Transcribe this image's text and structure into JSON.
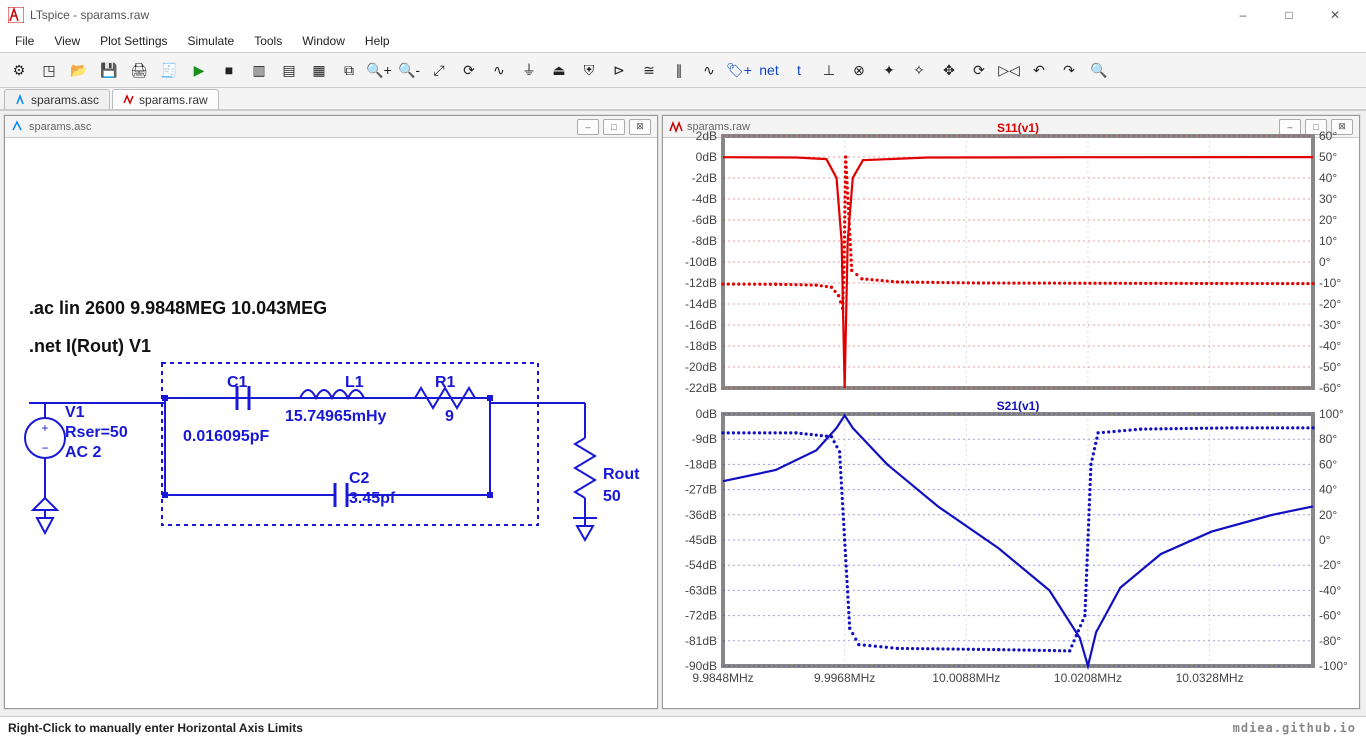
{
  "window": {
    "title": "LTspice - sparams.raw",
    "minimize": "–",
    "maximize": "□",
    "close": "✕"
  },
  "menu": [
    "File",
    "View",
    "Plot Settings",
    "Simulate",
    "Tools",
    "Window",
    "Help"
  ],
  "toolbar_icons": [
    "settings",
    "new-symbol",
    "open",
    "save",
    "print",
    "log",
    "run",
    "halt",
    "window-tile",
    "windows-h",
    "windows-v",
    "copy",
    "zoom-in",
    "zoom-out",
    "zoom-fit",
    "autorange",
    "sine",
    "ground-wire",
    "ground",
    "shield",
    "diode",
    "resistor",
    "capacitor",
    "inductor",
    "add-net",
    "net",
    "text",
    "pin-low",
    "pin-close",
    "marker-left",
    "marker-right",
    "move",
    "rotate",
    "mirror",
    "undo",
    "redo",
    "search"
  ],
  "doctabs": [
    {
      "label": "sparams.asc",
      "icon": "schematic-icon",
      "active": false
    },
    {
      "label": "sparams.raw",
      "icon": "waveform-icon",
      "active": true
    }
  ],
  "child_left": {
    "title": "sparams.asc",
    "directive1": ".ac lin 2600 9.9848MEG 10.043MEG",
    "directive2": ".net I(Rout) V1",
    "labels": {
      "V1_name": "V1",
      "V1_rser": "Rser=50",
      "V1_ac": "AC 2",
      "C1_name": "C1",
      "C1_val": "0.016095pF",
      "L1_name": "L1",
      "L1_val": "15.74965mHy",
      "R1_name": "R1",
      "R1_val": "9",
      "C2_name": "C2",
      "C2_val": "3.45pf",
      "Rout_name": "Rout",
      "Rout_val": "50"
    }
  },
  "child_right": {
    "title": "sparams.raw"
  },
  "chart_data": [
    {
      "type": "line",
      "title": "S11(v1)",
      "title_color": "#e00000",
      "xlabel": "",
      "ylabel_left": "dB",
      "ylabel_right": "degrees",
      "x_ticks": [
        "9.9848MHz",
        "9.9968MHz",
        "10.0088MHz",
        "10.0208MHz",
        "10.0328MHz"
      ],
      "y_left_ticks": [
        2,
        0,
        -2,
        -4,
        -6,
        -8,
        -10,
        -12,
        -14,
        -16,
        -18,
        -20,
        -22
      ],
      "y_right_ticks": [
        60,
        50,
        40,
        30,
        20,
        10,
        0,
        -10,
        -20,
        -30,
        -40,
        -50,
        -60
      ],
      "x_range": [
        9.9848,
        10.043
      ],
      "y_left_range": [
        -22,
        2
      ],
      "y_right_range": [
        -60,
        60
      ],
      "colors": {
        "mag": "#e00000",
        "phase": "#e00000"
      },
      "series": [
        {
          "name": "mag_dB",
          "style": "solid",
          "points": [
            [
              9.9848,
              -0.02
            ],
            [
              9.992,
              -0.05
            ],
            [
              9.995,
              -0.2
            ],
            [
              9.996,
              -2.0
            ],
            [
              9.9965,
              -8.0
            ],
            [
              9.9968,
              -22.0
            ],
            [
              9.9971,
              -8.0
            ],
            [
              9.9976,
              -2.0
            ],
            [
              9.9986,
              -0.3
            ],
            [
              10.005,
              -0.05
            ],
            [
              10.02,
              -0.02
            ],
            [
              10.043,
              -0.01
            ]
          ]
        },
        {
          "name": "phase_deg",
          "style": "dotted",
          "points": [
            [
              9.9848,
              -10.5
            ],
            [
              9.99,
              -10.6
            ],
            [
              9.994,
              -11.0
            ],
            [
              9.9955,
              -12.0
            ],
            [
              9.9962,
              -16.0
            ],
            [
              9.9966,
              -22.0
            ],
            [
              9.99675,
              0
            ],
            [
              9.9969,
              50
            ],
            [
              9.9975,
              -4.0
            ],
            [
              9.9985,
              -8.0
            ],
            [
              10.002,
              -9.5
            ],
            [
              10.01,
              -10.0
            ],
            [
              10.03,
              -10.2
            ],
            [
              10.043,
              -10.3
            ]
          ]
        }
      ]
    },
    {
      "type": "line",
      "title": "S21(v1)",
      "title_color": "#1010c0",
      "x_ticks": [
        "9.9848MHz",
        "9.9968MHz",
        "10.0088MHz",
        "10.0208MHz",
        "10.0328MHz"
      ],
      "y_left_ticks": [
        0,
        -9,
        -18,
        -27,
        -36,
        -45,
        -54,
        -63,
        -72,
        -81,
        -90
      ],
      "y_right_ticks": [
        100,
        80,
        60,
        40,
        20,
        0,
        -20,
        -40,
        -60,
        -80,
        -100
      ],
      "x_range": [
        9.9848,
        10.043
      ],
      "y_left_range": [
        -90,
        0
      ],
      "y_right_range": [
        -100,
        100
      ],
      "colors": {
        "mag": "#1010c0",
        "phase": "#1010c0"
      },
      "series": [
        {
          "name": "mag_dB",
          "style": "solid",
          "points": [
            [
              9.9848,
              -24
            ],
            [
              9.99,
              -20
            ],
            [
              9.994,
              -13
            ],
            [
              9.996,
              -5
            ],
            [
              9.9968,
              -0.5
            ],
            [
              9.9976,
              -5
            ],
            [
              10.001,
              -18
            ],
            [
              10.006,
              -33
            ],
            [
              10.012,
              -48
            ],
            [
              10.017,
              -63
            ],
            [
              10.02,
              -80
            ],
            [
              10.0208,
              -90
            ],
            [
              10.0216,
              -78
            ],
            [
              10.024,
              -62
            ],
            [
              10.028,
              -50
            ],
            [
              10.033,
              -42
            ],
            [
              10.039,
              -36
            ],
            [
              10.043,
              -33
            ]
          ]
        },
        {
          "name": "phase_deg",
          "style": "dotted",
          "points": [
            [
              9.9848,
              85
            ],
            [
              9.992,
              85
            ],
            [
              9.9955,
              82
            ],
            [
              9.9963,
              70
            ],
            [
              9.9968,
              0
            ],
            [
              9.9973,
              -70
            ],
            [
              9.9982,
              -83
            ],
            [
              10.002,
              -86
            ],
            [
              10.012,
              -87
            ],
            [
              10.019,
              -88
            ],
            [
              10.0205,
              -60
            ],
            [
              10.0208,
              0
            ],
            [
              10.0211,
              60
            ],
            [
              10.0218,
              85
            ],
            [
              10.026,
              88
            ],
            [
              10.035,
              89
            ],
            [
              10.043,
              89
            ]
          ]
        }
      ]
    }
  ],
  "statusbar": {
    "text": "Right-Click to manually enter Horizontal Axis Limits"
  },
  "watermark": "mdiea.github.io"
}
